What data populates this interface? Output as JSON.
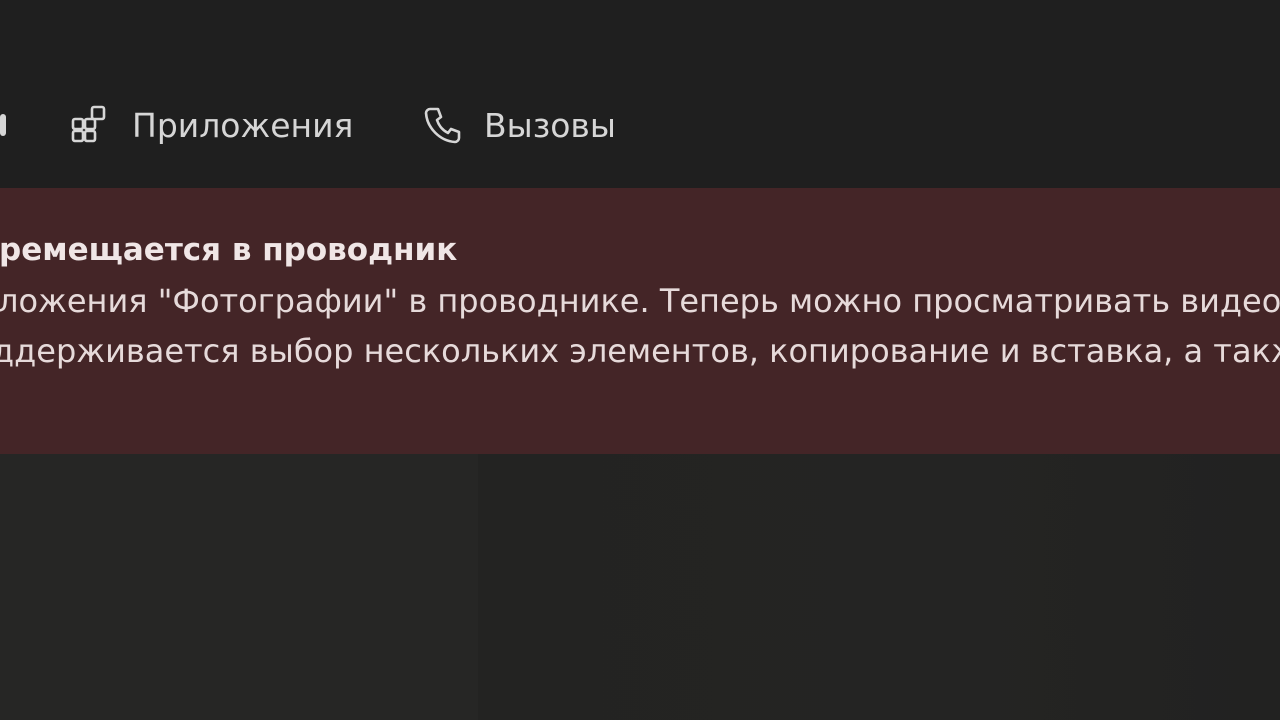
{
  "nav": {
    "items": [
      {
        "label": "Приложения",
        "icon": "apps-grid-icon"
      },
      {
        "label": "Вызовы",
        "icon": "phone-icon"
      }
    ]
  },
  "banner": {
    "title": "еремещается в проводник",
    "line1": "ложения \"Фотографии\" в проводнике. Теперь можно просматривать видео",
    "line2": "ддерживается выбор нескольких элементов, копирование и вставка, а такж",
    "background": "#442527"
  },
  "colors": {
    "topbar": "#1f1f1f",
    "page": "#262626",
    "text": "#d6d6d6"
  }
}
